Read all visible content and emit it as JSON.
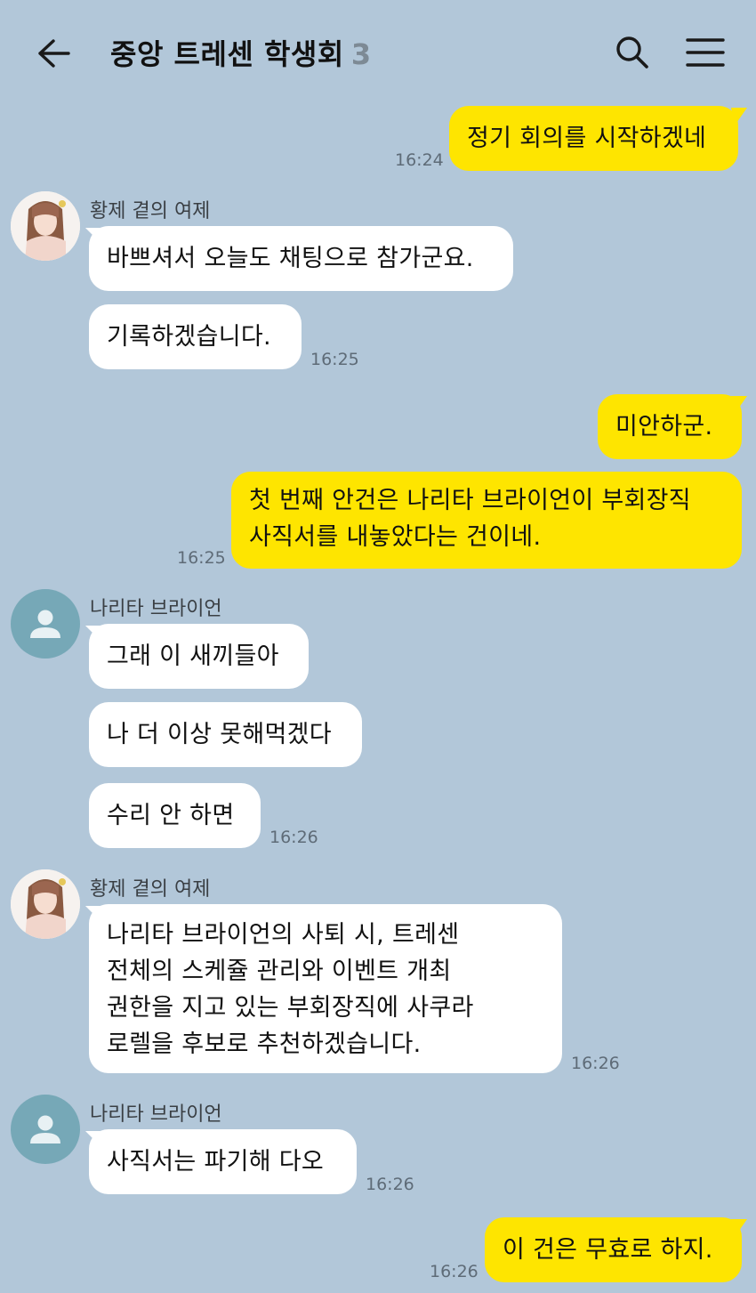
{
  "header": {
    "title": "중앙 트레센 학생회",
    "member_count": "3"
  },
  "colors": {
    "background": "#b2c7d9",
    "my_bubble": "#fee500",
    "other_bubble": "#ffffff",
    "default_avatar": "#76a8b7"
  },
  "icons": {
    "back": "arrow-left-icon",
    "search": "search-icon",
    "menu": "hamburger-menu-icon",
    "default_avatar": "person-icon"
  },
  "messages": {
    "m1": {
      "text": "정기 회의를 시작하겠네",
      "time": "16:24"
    },
    "g1": {
      "sender": "황제 곁의 여제",
      "b1": "바쁘셔서 오늘도 채팅으로 참가군요.",
      "b2": "기록하겠습니다.",
      "time": "16:25"
    },
    "m2": {
      "b1": "미안하군.",
      "b2_line1": "첫 번째 안건은 나리타 브라이언이 부회장직",
      "b2_line2": "사직서를 내놓았다는 건이네.",
      "time": "16:25"
    },
    "g2": {
      "sender": "나리타 브라이언",
      "b1": "그래 이 새끼들아",
      "b2": "나 더 이상 못해먹겠다",
      "b3": "수리 안 하면",
      "time": "16:26"
    },
    "g3": {
      "sender": "황제 곁의 여제",
      "line1": "나리타 브라이언의 사퇴 시, 트레센",
      "line2": "전체의 스케쥴 관리와 이벤트 개최",
      "line3": "권한을 지고 있는 부회장직에 사쿠라",
      "line4": "로렐을 후보로 추천하겠습니다.",
      "time": "16:26"
    },
    "g4": {
      "sender": "나리타 브라이언",
      "b1": "사직서는 파기해 다오",
      "time": "16:26"
    },
    "m3": {
      "text": "이 건은 무효로 하지.",
      "time": "16:26"
    }
  }
}
